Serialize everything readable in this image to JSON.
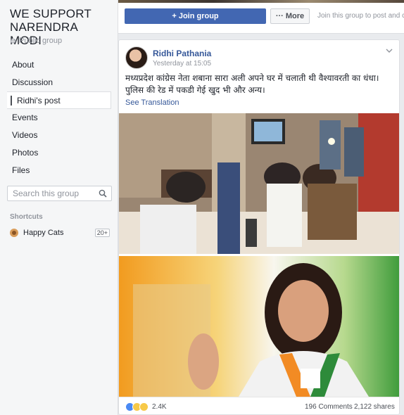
{
  "group": {
    "name": "WE SUPPORT NARENDRA MODI",
    "privacy": "Public group"
  },
  "nav": [
    {
      "label": "About"
    },
    {
      "label": "Discussion"
    },
    {
      "label": "Ridhi's post"
    },
    {
      "label": "Events"
    },
    {
      "label": "Videos"
    },
    {
      "label": "Photos"
    },
    {
      "label": "Files"
    }
  ],
  "search": {
    "placeholder": "Search this group"
  },
  "shortcuts": {
    "title": "Shortcuts",
    "items": [
      {
        "label": "Happy Cats",
        "badge": "20+",
        "icon": "cat-group-icon"
      }
    ]
  },
  "actions": {
    "join_label": "+ Join group",
    "more_label": "More",
    "join_hint": "Join this group to post and co"
  },
  "post": {
    "author": "Ridhi Pathania",
    "time": "Yesterday at 15:05",
    "text": "मध्यप्रदेश कांग्रेस नेता शबाना सारा अली अपने घर में चलाती थी वैश्यावरती का धंधा। पुलिस की रेड में पकडी गेई खुद भी और अन्य।",
    "see_translation": "See Translation",
    "reactions_count": "2.4K",
    "comments": "196 Comments",
    "shares": "2,122 shares"
  },
  "colors": {
    "accent": "#4267b2",
    "link": "#365899"
  }
}
